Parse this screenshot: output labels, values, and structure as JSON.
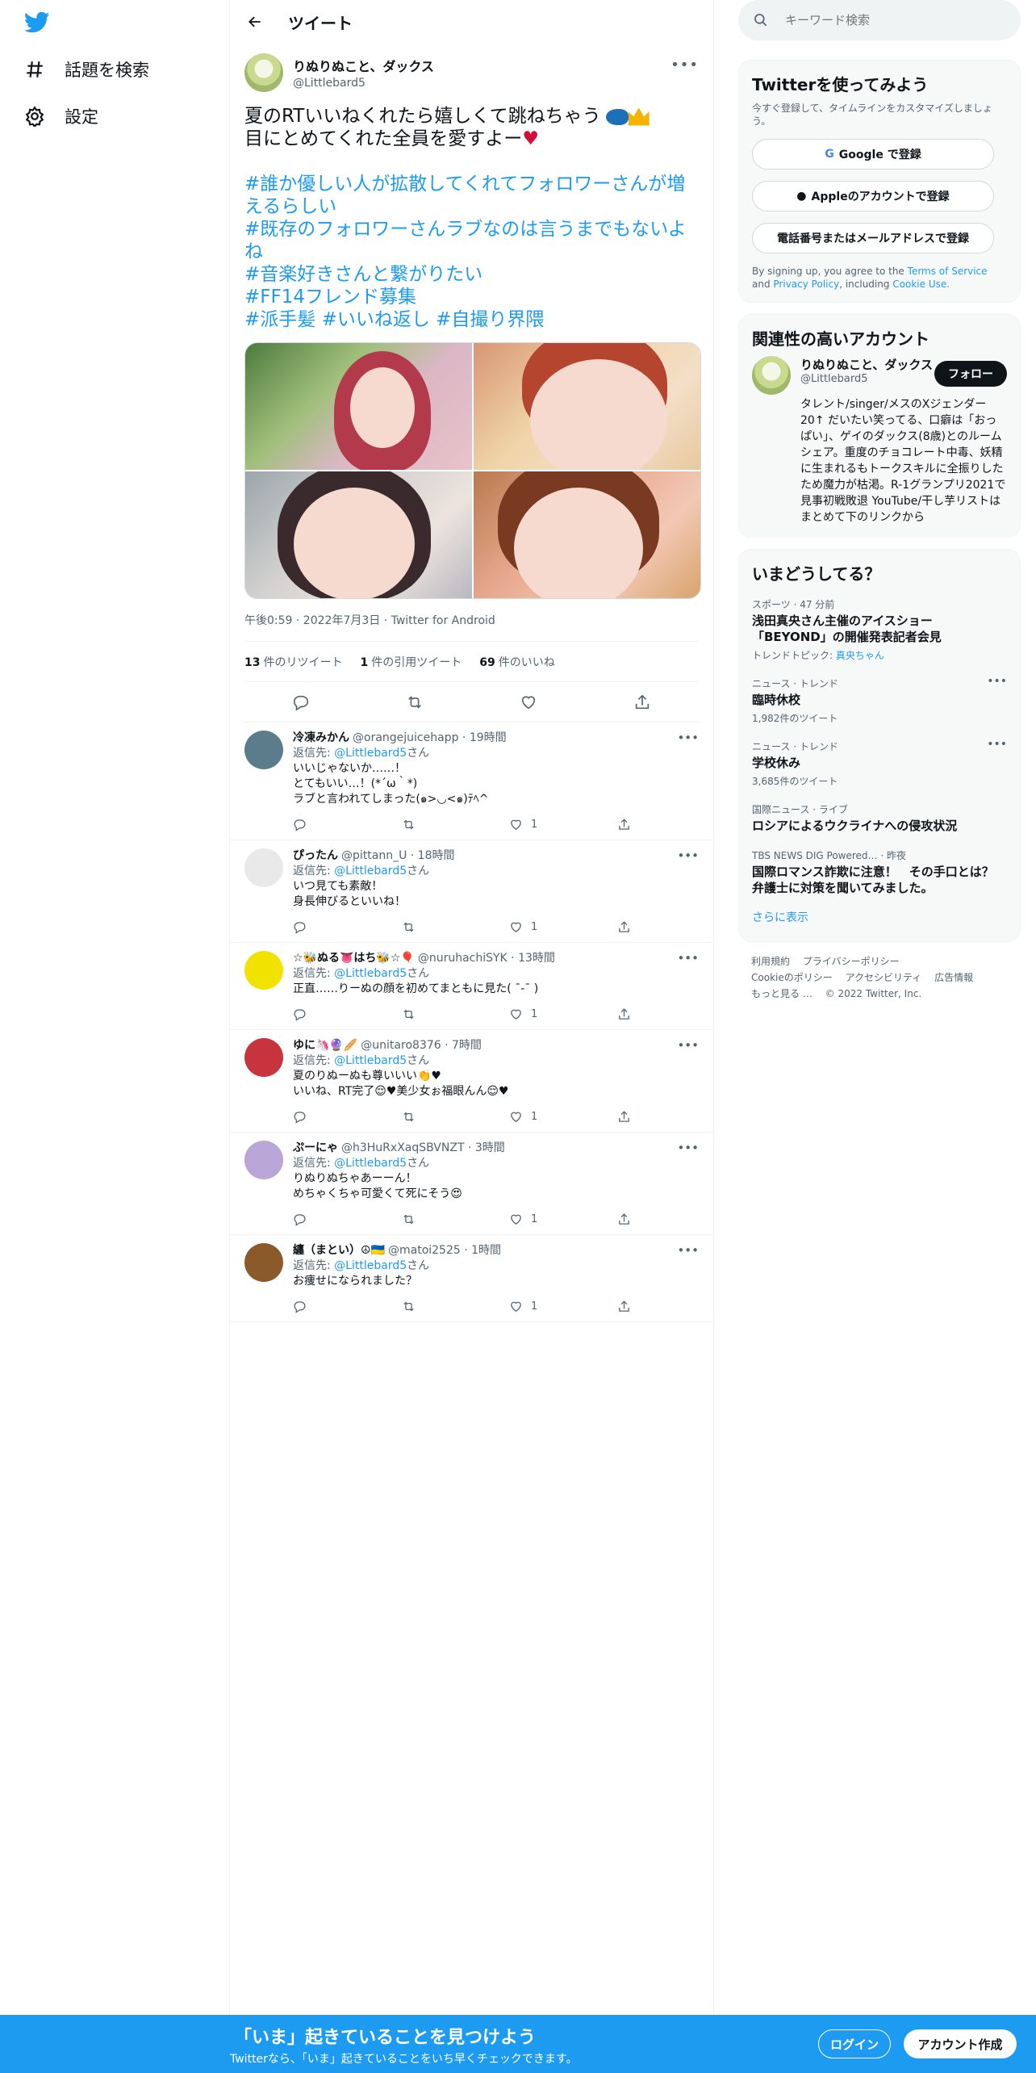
{
  "nav": {
    "explore": "話題を検索",
    "settings": "設定"
  },
  "header": {
    "title": "ツイート"
  },
  "tweet": {
    "display_name": "りぬりぬこと、ダックス",
    "handle": "@Littlebard5",
    "text_line1": "夏のRTいいねくれたら嬉しくて跳ねちゃう",
    "text_line2": "目にとめてくれた全員を愛すよー",
    "heart": "♥",
    "hashtags": [
      "#誰か優しい人が拡散してくれてフォロワーさんが増",
      "えるらしい",
      "#既存のフォロワーさんラブなのは言うまでもないよ",
      "ね",
      "#音楽好きさんと繋がりたい",
      "#FF14フレンド募集",
      "#派手髪 #いいね返し #自撮り界隈"
    ],
    "meta": "午後0:59 · 2022年7月3日 · Twitter for Android",
    "retweets_count": "13",
    "retweets_label": "件のリツイート",
    "quotes_count": "1",
    "quotes_label": "件の引用ツイート",
    "likes_count": "69",
    "likes_label": "件のいいね"
  },
  "replies": [
    {
      "name": "冷凍みかん",
      "handle": "@orangejuicehapp · 19時間",
      "reply_prefix": "返信先:",
      "reply_to": "@Littlebard5",
      "reply_suffix": "さん",
      "lines": [
        "いいじゃないか……！",
        "とてもいい…！(*´ω｀*)",
        "ラブと言われてしまった(๑>◡<๑)ﾃﾍ^"
      ],
      "likes": "1",
      "avatar_color": "#5b7c8a"
    },
    {
      "name": "ぴったん",
      "handle": "@pittann_U · 18時間",
      "reply_prefix": "返信先:",
      "reply_to": "@Littlebard5",
      "reply_suffix": "さん",
      "lines": [
        "いつ見ても素敵！",
        "身長伸びるといいね！"
      ],
      "likes": "1",
      "avatar_color": "#e9e9e9"
    },
    {
      "name": "☆🐝ぬる👅はち🐝☆🎈",
      "handle": "@nuruhachiSYK · 13時間",
      "reply_prefix": "返信先:",
      "reply_to": "@Littlebard5",
      "reply_suffix": "さん",
      "lines": [
        "正直……りーぬの顔を初めてまともに見た( ¯-¯ )"
      ],
      "likes": "1",
      "avatar_color": "#f2e200"
    },
    {
      "name": "ゆに🦄🔮🥖",
      "handle": "@unitaro8376 · 7時間",
      "reply_prefix": "返信先:",
      "reply_to": "@Littlebard5",
      "reply_suffix": "さん",
      "lines": [
        "夏のりぬーぬも尊いいい👏♥",
        "いいね、RT完了😌♥美少女ぉ福眼んん😌♥"
      ],
      "likes": "1",
      "avatar_color": "#c8343d"
    },
    {
      "name": "ぷーにゃ",
      "handle": "@h3HuRxXaqSBVNZT · 3時間",
      "reply_prefix": "返信先:",
      "reply_to": "@Littlebard5",
      "reply_suffix": "さん",
      "lines": [
        "りぬりぬちゃあーーん！",
        "めちゃくちゃ可愛くて死にそう😍"
      ],
      "likes": "1",
      "avatar_color": "#b9a6d6"
    },
    {
      "name": "纏（まとい）☮🇺🇦",
      "handle": "@matoi2525 · 1時間",
      "reply_prefix": "返信先:",
      "reply_to": "@Littlebard5",
      "reply_suffix": "さん",
      "lines": [
        "お痩せになられました？"
      ],
      "likes": "1",
      "avatar_color": "#8a5a2b"
    }
  ],
  "search": {
    "placeholder": "キーワード検索"
  },
  "signup_card": {
    "title": "Twitterを使ってみよう",
    "subtitle": "今すぐ登録して、タイムラインをカスタマイズしましょう。",
    "google_label": "Google で登録",
    "apple_label": "Appleのアカウントで登録",
    "phone_label": "電話番号またはメールアドレスで登録",
    "terms_prefix": "By signing up, you agree to the",
    "terms_link": "Terms of Service",
    "terms_and": "and",
    "privacy_link": "Privacy Policy",
    "terms_including": ", including",
    "cookie_link": "Cookie Use."
  },
  "relevant": {
    "title": "関連性の高いアカウント",
    "name": "りぬりぬこと、ダックス",
    "handle": "@Littlebard5",
    "follow_label": "フォロー",
    "bio": "タレント/singer/メスのXジェンダー20↑ だいたい笑ってる、口癖は「おっぱい」、ゲイのダックス(8歳)とのルームシェア。重度のチョコレート中毒、妖精に生まれるもトークスキルに全振りしたため魔力が枯渇。R-1グランプリ2021で見事初戦敗退 YouTube/干し芋リストはまとめて下のリンクから"
  },
  "trends": {
    "title": "いまどうしてる？",
    "items": [
      {
        "category": "スポーツ · 47 分前",
        "name": "浅田真央さん主催のアイスショー「BEYOND」の開催発表記者会見",
        "extra_prefix": "トレンドトピック:",
        "extra_link": "真央ちゃん"
      },
      {
        "category": "ニュース · トレンド",
        "name": "臨時休校",
        "count": "1,982件のツイート"
      },
      {
        "category": "ニュース · トレンド",
        "name": "学校休み",
        "count": "3,685件のツイート"
      },
      {
        "category": "国際ニュース · ライブ",
        "name": "ロシアによるウクライナへの侵攻状況"
      },
      {
        "category": "TBS NEWS DIG Powered… · 昨夜",
        "name": "国際ロマンス詐欺に注意！　その手口とは？　弁護士に対策を聞いてみました。"
      }
    ],
    "show_more": "さらに表示"
  },
  "footer": {
    "links": [
      "利用規約",
      "プライバシーポリシー",
      "Cookieのポリシー",
      "アクセシビリティ",
      "広告情報",
      "もっと見る …",
      "© 2022 Twitter, Inc."
    ]
  },
  "bottom_bar": {
    "title": "「いま」起きていることを見つけよう",
    "subtitle": "Twitterなら、「いま」起きていることをいち早くチェックできます。",
    "login_label": "ログイン",
    "signup_label": "アカウント作成"
  }
}
